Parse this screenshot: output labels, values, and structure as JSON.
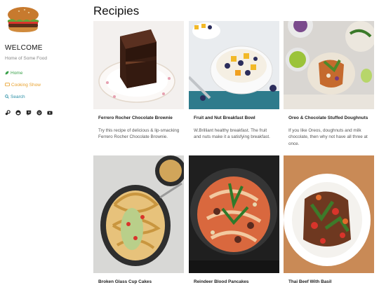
{
  "sidebar": {
    "site_title": "WELCOME",
    "tagline": "Home of Some Food",
    "nav": [
      {
        "label": "Home",
        "icon": "leaf-icon"
      },
      {
        "label": "Cooking Show",
        "icon": "tv-icon"
      },
      {
        "label": "Search",
        "icon": "search-icon"
      }
    ],
    "socials": [
      "steam-icon",
      "reddit-icon",
      "twitch-icon",
      "spotify-icon",
      "youtube-icon"
    ]
  },
  "main": {
    "title": "Recipies",
    "cards": [
      {
        "title": "Ferrero Rocher Chocolate Brownie",
        "desc": "Try this recipe of delicious & lip-smacking Ferrero Rocher Chocolate Brownie."
      },
      {
        "title": "Fruit and Nut Breakfast Bowl",
        "desc": "W.Brilliant healthy breakfast. The fruit and nuts make it a satisfying breakfast."
      },
      {
        "title": "Oreo & Chocolate Stuffed Doughnuts",
        "desc": "If you like Oreos, doughnuts and milk chocolate, then why not have all three at once."
      },
      {
        "title": "Broken Glass Cup Cakes",
        "desc": ""
      },
      {
        "title": "Reindeer Blood Pancakes",
        "desc": ""
      },
      {
        "title": "Thai Beef With Basil",
        "desc": ""
      }
    ]
  },
  "colors": {
    "home": "#3aa14a",
    "cooking": "#e8a02b",
    "search": "#2a8fa6"
  }
}
